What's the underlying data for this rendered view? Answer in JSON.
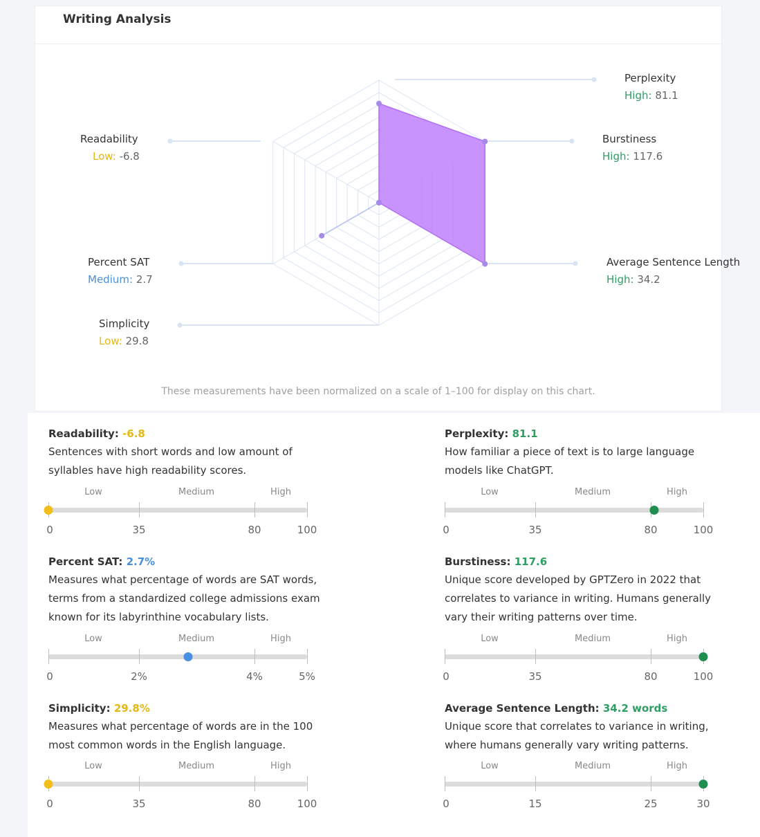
{
  "card_title": "Writing Analysis",
  "radar_note": "These measurements have been normalized on a scale of 1–100 for display on this chart.",
  "colors": {
    "high": "#2e9e63",
    "low": "#e7b715",
    "medium": "#4a90d9",
    "radar_fill": "#c084fc",
    "dot_high": "#1f8f4f",
    "dot_low": "#f2be1a",
    "dot_medium": "#4a90e2"
  },
  "radar": {
    "axes": [
      {
        "name": "Perplexity",
        "level": "High:",
        "value": "81.1"
      },
      {
        "name": "Burstiness",
        "level": "High:",
        "value": "117.6"
      },
      {
        "name": "Average Sentence Length",
        "level": "High:",
        "value": "34.2"
      },
      {
        "name": "Readability",
        "level": "Low:",
        "value": "-6.8"
      },
      {
        "name": "Percent SAT",
        "level": "Medium:",
        "value": "2.7"
      },
      {
        "name": "Simplicity",
        "level": "Low:",
        "value": "29.8"
      }
    ]
  },
  "chart_data": {
    "type": "radar",
    "scale": [
      0,
      100
    ],
    "categories": [
      "Perplexity",
      "Burstiness",
      "Average Sentence Length",
      "Simplicity",
      "Percent SAT",
      "Readability"
    ],
    "normalized_values": [
      81,
      100,
      100,
      0,
      54,
      0
    ]
  },
  "metrics": [
    {
      "title": "Readability:",
      "value": "-6.8",
      "level": "low",
      "desc": [
        "Sentences with short words and low amount of",
        "syllables have high readability scores."
      ],
      "bands": [
        "Low",
        "Medium",
        "High"
      ],
      "ticks": [
        "0",
        "35",
        "80",
        "100"
      ],
      "marker_fraction": 0
    },
    {
      "title": "Perplexity:",
      "value": "81.1",
      "level": "high",
      "desc": [
        "How familiar a piece of text is to large language",
        "models like ChatGPT."
      ],
      "bands": [
        "Low",
        "Medium",
        "High"
      ],
      "ticks": [
        "0",
        "35",
        "80",
        "100"
      ],
      "marker_fraction": 0.81
    },
    {
      "title": "Percent SAT:",
      "value": "2.7%",
      "level": "medium",
      "desc": [
        "Measures what percentage of words are SAT words,",
        "terms from a standardized college admissions exam",
        "known for its labyrinthine vocabulary lists."
      ],
      "bands": [
        "Low",
        "Medium",
        "High"
      ],
      "ticks": [
        "0",
        "2%",
        "4%",
        "5%"
      ],
      "marker_fraction": 0.54
    },
    {
      "title": "Burstiness:",
      "value": "117.6",
      "level": "high",
      "desc": [
        "Unique score developed by GPTZero in 2022 that",
        "correlates to variance in writing. Humans generally",
        "vary their writing patterns over time."
      ],
      "bands": [
        "Low",
        "Medium",
        "High"
      ],
      "ticks": [
        "0",
        "35",
        "80",
        "100"
      ],
      "marker_fraction": 1
    },
    {
      "title": "Simplicity:",
      "value": "29.8%",
      "level": "low",
      "desc": [
        "Measures what percentage of words are in the 100",
        "most common words in the English language."
      ],
      "bands": [
        "Low",
        "Medium",
        "High"
      ],
      "ticks": [
        "0",
        "35",
        "80",
        "100"
      ],
      "marker_fraction": 0
    },
    {
      "title": "Average Sentence Length:",
      "value": "34.2 words",
      "level": "high",
      "desc": [
        "Unique score that correlates to variance in writing,",
        "where humans generally vary writing patterns."
      ],
      "bands": [
        "Low",
        "Medium",
        "High"
      ],
      "ticks": [
        "0",
        "15",
        "25",
        "30"
      ],
      "marker_fraction": 1
    }
  ]
}
